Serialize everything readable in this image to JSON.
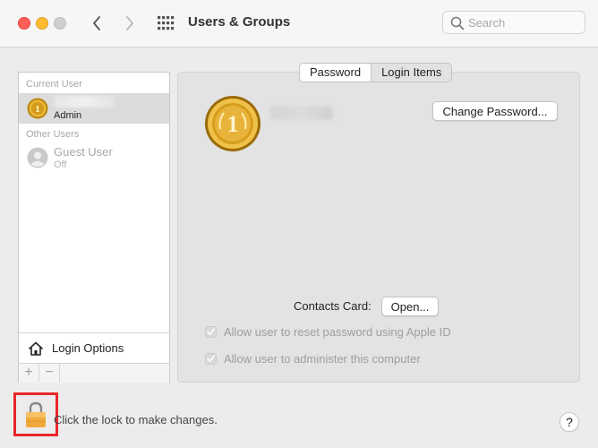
{
  "window": {
    "title": "Users & Groups"
  },
  "search": {
    "placeholder": "Search"
  },
  "sidebar": {
    "current_user_label": "Current User",
    "current_user": {
      "name": "",
      "role": "Admin"
    },
    "other_users_label": "Other Users",
    "other_users": [
      {
        "name": "Guest User",
        "status": "Off"
      }
    ],
    "login_options_label": "Login Options",
    "add_label": "+",
    "remove_label": "−"
  },
  "tabs": [
    {
      "label": "Password",
      "active": true
    },
    {
      "label": "Login Items",
      "active": false
    }
  ],
  "main": {
    "change_password_label": "Change Password...",
    "contacts_card_label": "Contacts Card:",
    "open_label": "Open...",
    "checkboxes": [
      {
        "label": "Allow user to reset password using Apple ID",
        "checked": true,
        "enabled": false
      },
      {
        "label": "Allow user to administer this computer",
        "checked": true,
        "enabled": false
      }
    ]
  },
  "footer": {
    "lock_text": "Click the lock to make changes.",
    "help_label": "?"
  },
  "colors": {
    "highlight_border": "#e8262a",
    "selected_row": "#dcdcdc",
    "traffic_red": "#ff5f57",
    "traffic_yellow": "#febc2e"
  },
  "icons": [
    "chevron-left-icon",
    "chevron-right-icon",
    "grid-icon",
    "search-icon",
    "gold-medal-avatar",
    "guest-avatar-icon",
    "house-icon",
    "lock-icon",
    "checkmark-icon"
  ]
}
